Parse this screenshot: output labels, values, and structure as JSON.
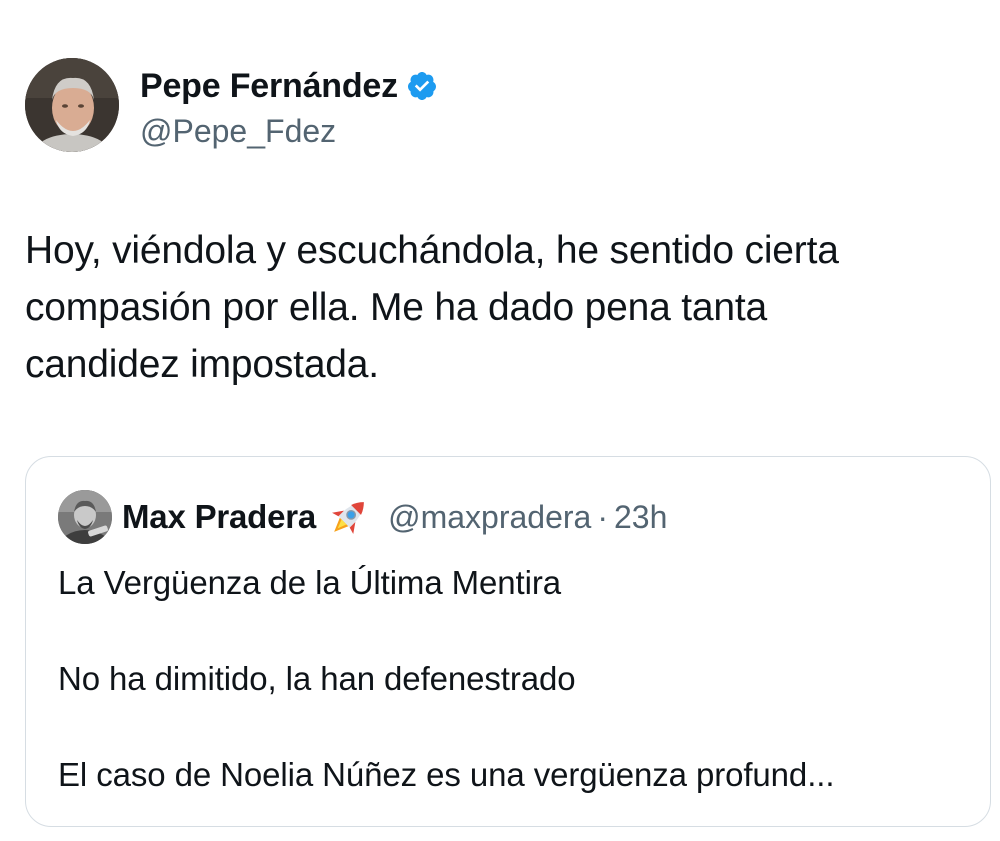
{
  "tweet": {
    "author": {
      "display_name": "Pepe Fernández",
      "handle": "@Pepe_Fdez",
      "verified": true,
      "verified_icon": "verified-badge-icon"
    },
    "text_lines": [
      "Hoy, viéndola y escuchándola, he sentido cierta",
      "compasión por ella. Me ha dado pena tanta",
      "candidez impostada."
    ]
  },
  "quote": {
    "author": {
      "display_name": "Max Pradera",
      "emoji": "🚀",
      "emoji_icon": "rocket-icon",
      "handle": "@maxpradera",
      "separator": "·",
      "time": "23h"
    },
    "lines": [
      "La Vergüenza de la Última Mentira",
      "No ha dimitido, la han defenestrado",
      "El caso de Noelia Núñez es una vergüenza profund..."
    ]
  },
  "colors": {
    "text": "#0f1419",
    "secondary": "#536471",
    "verified": "#1d9bf0",
    "border": "#d6dde3"
  }
}
